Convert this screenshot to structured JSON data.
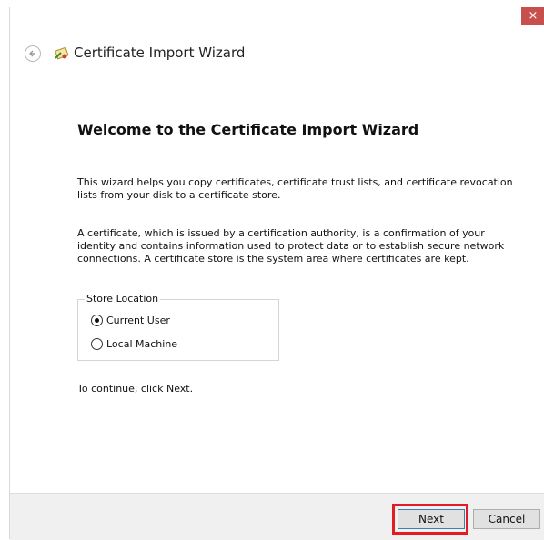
{
  "window": {
    "close_glyph": "×",
    "title": "Certificate Import Wizard"
  },
  "content": {
    "heading": "Welcome to the Certificate Import Wizard",
    "para1": "This wizard helps you copy certificates, certificate trust lists, and certificate revocation lists from your disk to a certificate store.",
    "para2": "A certificate, which is issued by a certification authority, is a confirmation of your identity and contains information used to protect data or to establish secure network connections. A certificate store is the system area where certificates are kept.",
    "store_location": {
      "label": "Store Location",
      "options": [
        {
          "label": "Current User",
          "checked": true
        },
        {
          "label": "Local Machine",
          "checked": false
        }
      ]
    },
    "para3": "To continue, click Next."
  },
  "footer": {
    "next_label": "Next",
    "cancel_label": "Cancel"
  },
  "colors": {
    "close_bg": "#c7504d",
    "highlight": "#e31c23",
    "footer_bg": "#f0f0f0"
  },
  "icons": {
    "back": "back-arrow-icon",
    "wizard": "certificate-icon"
  }
}
